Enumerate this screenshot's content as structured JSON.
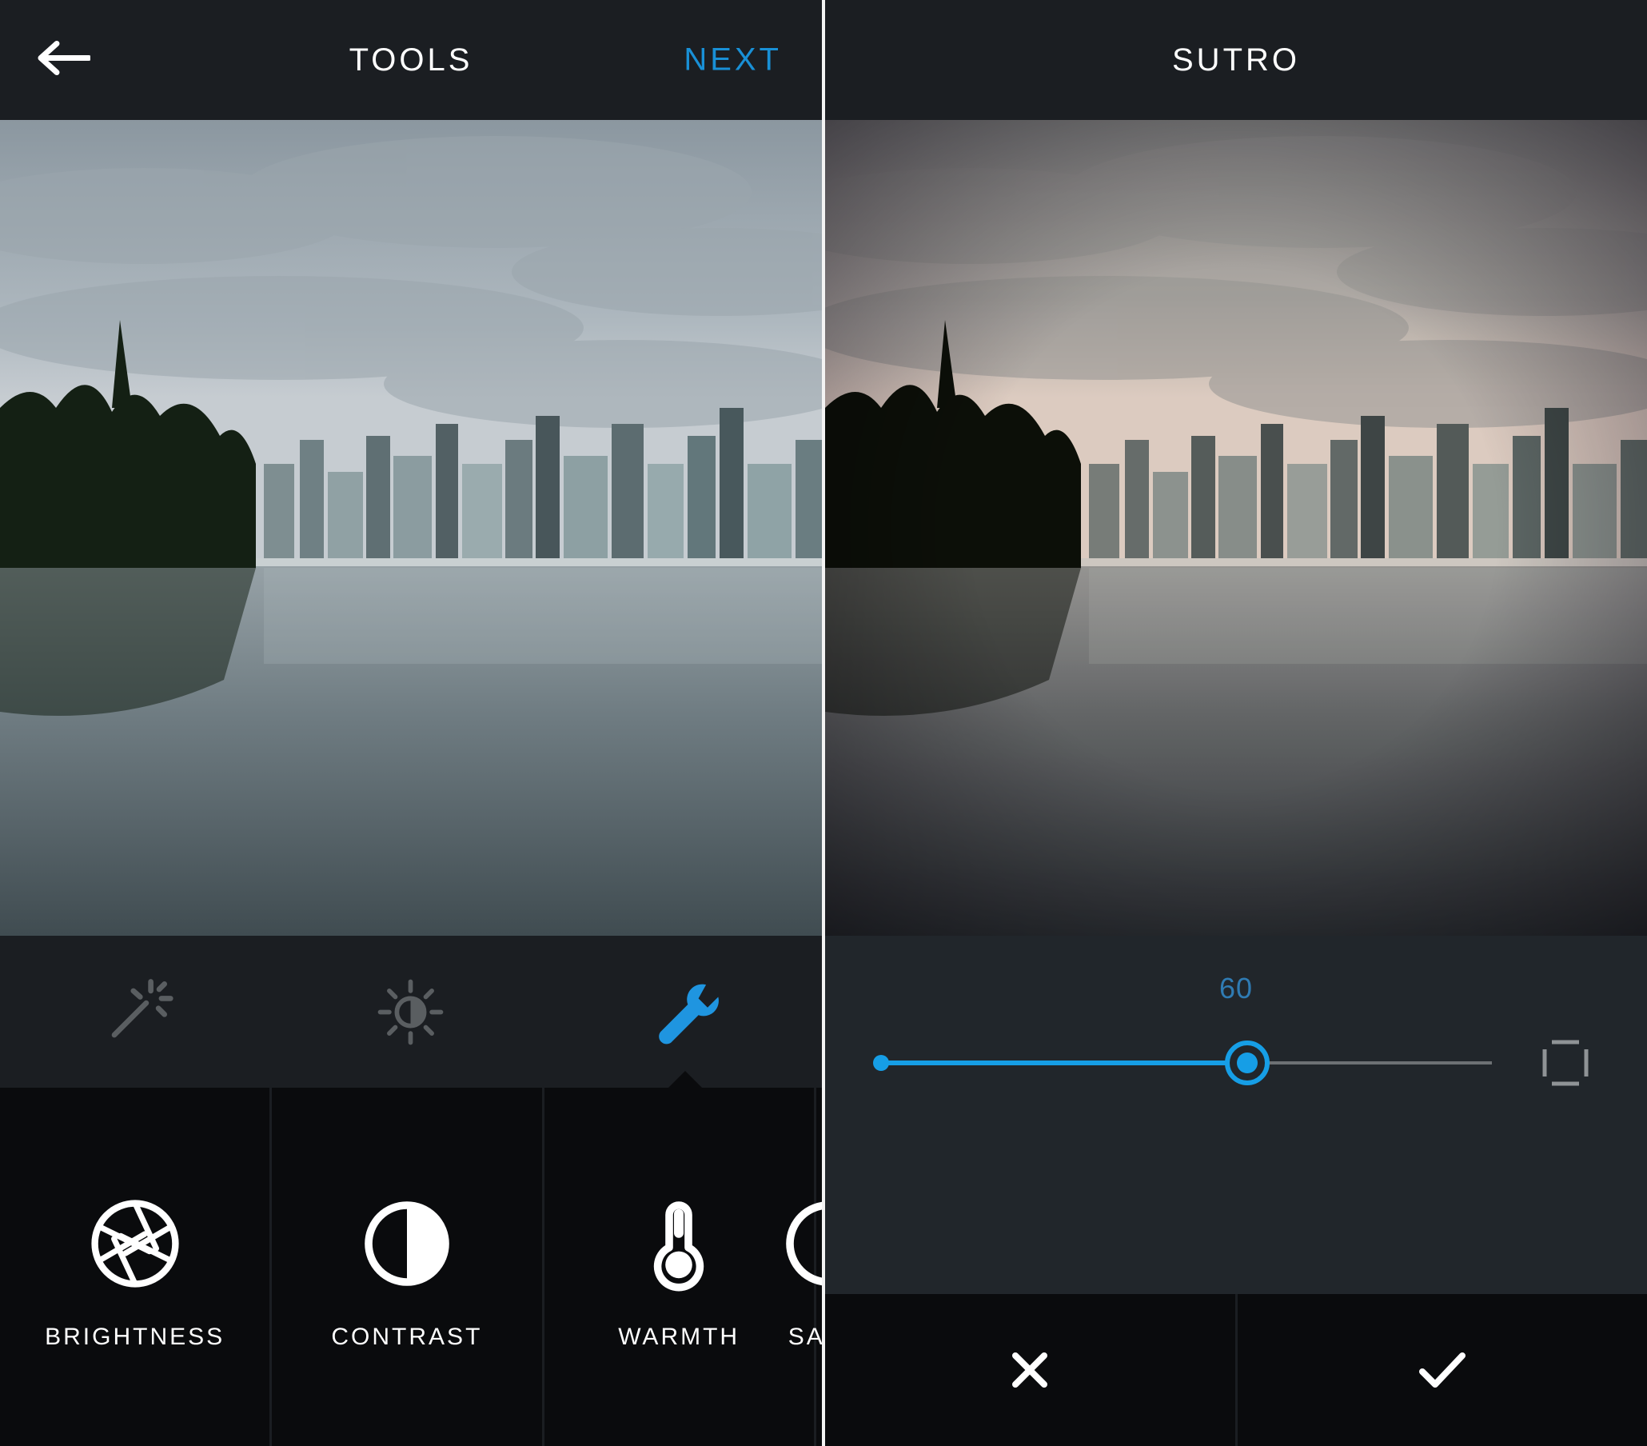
{
  "left": {
    "header": {
      "title": "TOOLS",
      "next": "NEXT"
    },
    "tabs": {
      "active_index": 2,
      "items": [
        "magic-wand",
        "lux",
        "wrench"
      ]
    },
    "tools": [
      {
        "id": "brightness",
        "label": "BRIGHTNESS"
      },
      {
        "id": "contrast",
        "label": "CONTRAST"
      },
      {
        "id": "warmth",
        "label": "WARMTH"
      },
      {
        "id": "saturation",
        "label": "SATU"
      }
    ]
  },
  "right": {
    "header": {
      "title": "SUTRO"
    },
    "slider": {
      "value": 60,
      "min": 0,
      "max": 100
    },
    "colors": {
      "accent": "#169ee6"
    }
  }
}
